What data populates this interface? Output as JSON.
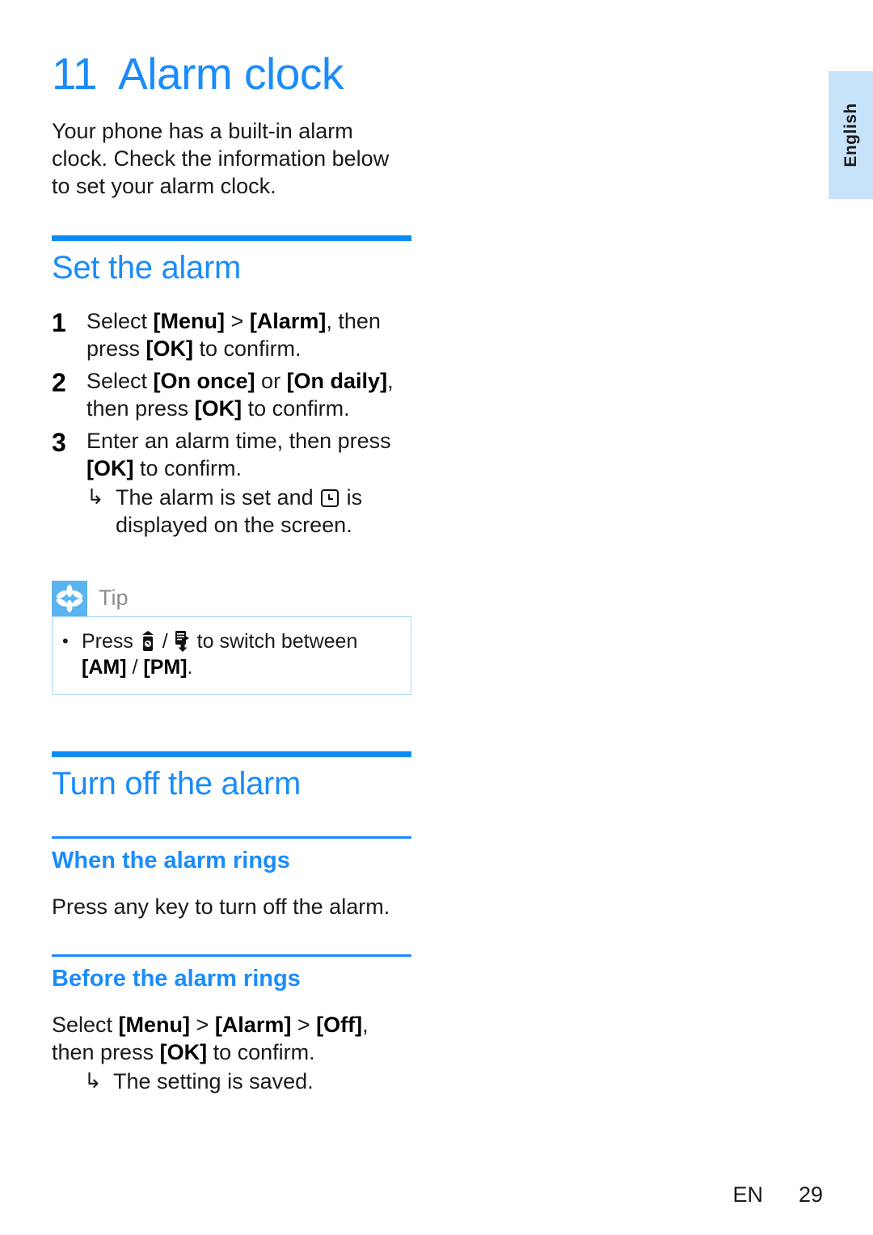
{
  "sidebar": {
    "language_tab": "English"
  },
  "chapter": {
    "number": "11",
    "title": "Alarm clock",
    "intro": "Your phone has a built-in alarm clock. Check the information below to set your alarm clock."
  },
  "sections": [
    {
      "title": "Set the alarm",
      "steps": [
        {
          "number": "1",
          "parts": [
            {
              "t": "Select ",
              "b": false
            },
            {
              "t": "[Menu]",
              "b": true
            },
            {
              "t": " > ",
              "b": false
            },
            {
              "t": "[Alarm]",
              "b": true
            },
            {
              "t": ", then press ",
              "b": false
            },
            {
              "t": "[OK]",
              "b": true
            },
            {
              "t": " to confirm.",
              "b": false
            }
          ]
        },
        {
          "number": "2",
          "parts": [
            {
              "t": "Select ",
              "b": false
            },
            {
              "t": "[On once]",
              "b": true
            },
            {
              "t": " or ",
              "b": false
            },
            {
              "t": "[On daily]",
              "b": true
            },
            {
              "t": ", then press ",
              "b": false
            },
            {
              "t": "[OK]",
              "b": true
            },
            {
              "t": " to confirm.",
              "b": false
            }
          ]
        },
        {
          "number": "3",
          "parts": [
            {
              "t": "Enter an alarm time, then press ",
              "b": false
            },
            {
              "t": "[OK]",
              "b": true
            },
            {
              "t": " to confirm.",
              "b": false
            }
          ],
          "result_before": "The alarm is set and ",
          "result_icon": "clock-icon",
          "result_after": " is displayed on the screen.",
          "result_arrow": "↳"
        }
      ],
      "tip": {
        "icon": "tip-asterisk-icon",
        "label": "Tip",
        "bullet": "•",
        "item_parts": [
          {
            "t": "Press ",
            "b": false
          },
          {
            "icon": "softkey-phonebook-up-icon"
          },
          {
            "t": " / ",
            "b": false
          },
          {
            "icon": "softkey-menu-down-icon"
          },
          {
            "t": " to switch between ",
            "b": false
          },
          {
            "t": "[AM]",
            "b": true
          },
          {
            "t": " / ",
            "b": false
          },
          {
            "t": "[PM]",
            "b": true
          },
          {
            "t": ".",
            "b": false
          }
        ]
      }
    },
    {
      "title": "Turn off the alarm",
      "subsections": [
        {
          "title": "When the alarm rings",
          "body_parts": [
            {
              "t": "Press any key to turn off the alarm.",
              "b": false
            }
          ]
        },
        {
          "title": "Before the alarm rings",
          "body_parts": [
            {
              "t": "Select ",
              "b": false
            },
            {
              "t": "[Menu]",
              "b": true
            },
            {
              "t": " > ",
              "b": false
            },
            {
              "t": "[Alarm]",
              "b": true
            },
            {
              "t": " > ",
              "b": false
            },
            {
              "t": "[Off]",
              "b": true
            },
            {
              "t": ", then press ",
              "b": false
            },
            {
              "t": "[OK]",
              "b": true
            },
            {
              "t": " to confirm.",
              "b": false
            }
          ],
          "result_arrow": "↳",
          "result_text": "The setting is saved."
        }
      ]
    }
  ],
  "footer": {
    "language_code": "EN",
    "page_number": "29"
  }
}
